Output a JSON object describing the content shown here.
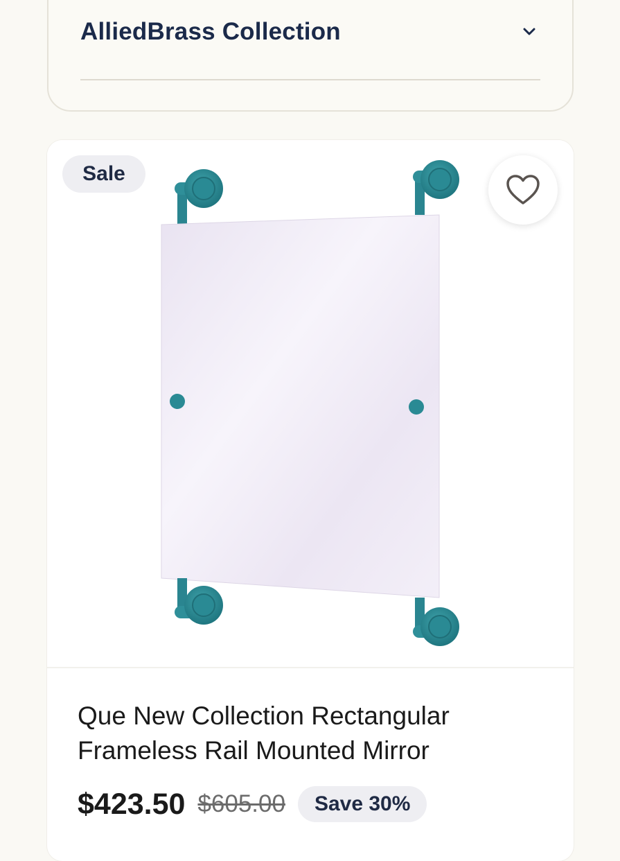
{
  "collection": {
    "title": "AlliedBrass Collection",
    "expand_icon": "chevron-down-icon"
  },
  "product": {
    "badge": "Sale",
    "favorite_icon": "heart-outline-icon",
    "image_description_icon": "rectangular-mirror-image",
    "title": "Que New Collection Rectangular Frameless Rail Mounted Mirror",
    "price": "$423.50",
    "original_price": "$605.00",
    "save_label": "Save 30%"
  },
  "colors": {
    "accent_teal": "#2f8a93",
    "text_dark": "#1b2a4a",
    "badge_bg": "#eeeef2"
  }
}
